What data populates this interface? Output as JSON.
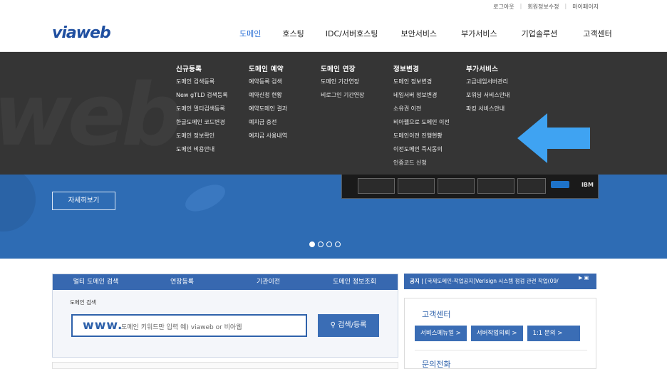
{
  "util_links": [
    "로그아웃",
    "회원정보수정",
    "마이페이지"
  ],
  "logo": "viaweb",
  "gnb": [
    "도메인",
    "호스팅",
    "IDC/서버호스팅",
    "보안서비스",
    "부가서비스",
    "기업솔루션",
    "고객센터"
  ],
  "mega_menu": {
    "bg_text": "web",
    "columns": [
      {
        "title": "신규등록",
        "items": [
          "도메인 검색등록",
          "New gTLD 검색등록",
          "도메인 멀티검색등록",
          "한글도메인 코드변경",
          "도메인 정보확인",
          "도메인 비용안내"
        ]
      },
      {
        "title": "도메인 예약",
        "items": [
          "예약등록 검색",
          "예약신청 현황",
          "예약도메인 결과",
          "예치금 충전",
          "예치금 사용내역"
        ]
      },
      {
        "title": "도메인 연장",
        "items": [
          "도메인 기간연장",
          "비로그인 기간연장"
        ]
      },
      {
        "title": "정보변경",
        "items": [
          "도메인 정보변경",
          "네임서버 정보변경",
          "소유권 이전",
          "비아웹으로 도메인 이전",
          "도메인이전 진행현황",
          "이전도메인 즉시동의",
          "인증코드 신청"
        ]
      },
      {
        "title": "부가서비스",
        "items": [
          "고급네임서버관리",
          "포워딩 서비스안내",
          "파킹 서비스안내"
        ]
      }
    ]
  },
  "hero": {
    "detail_button": "자세히보기",
    "server_brand": "IBM"
  },
  "search": {
    "tabs": [
      "멀티 도메인 검색",
      "연장등록",
      "기관이전",
      "도메인 정보조회"
    ],
    "label": "도메인 검색",
    "prefix": "www.",
    "placeholder": "도메인 키워드만 입력 예) viaweb or 비아웹",
    "button": "검색/등록"
  },
  "notice": {
    "prefix": "공지 |",
    "text": "[국제도메인-작업공지]Verisign 시스템 점검 관련 작업(09/"
  },
  "customer_center": {
    "title": "고객센터",
    "buttons": [
      "서비스메뉴얼 >",
      "서버작업의뢰 >",
      "1:1 문의  >"
    ],
    "sub_title": "문의전화"
  },
  "colors": {
    "brand": "#1f4fa0",
    "menu_bg": "#353535",
    "hero_bg": "#2e6cb4",
    "arrow": "#3fa3f2"
  }
}
